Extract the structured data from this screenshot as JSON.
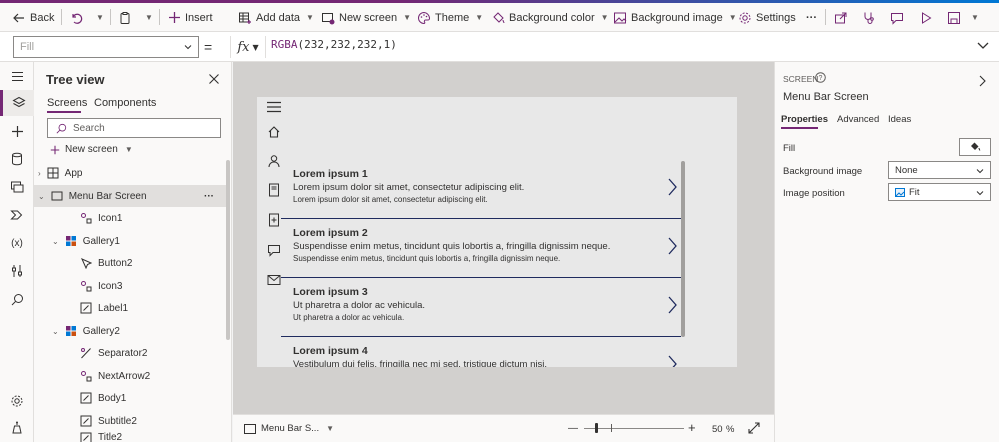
{
  "toolbar": {
    "back": "Back",
    "insert": "Insert",
    "add_data": "Add data",
    "new_screen": "New screen",
    "theme": "Theme",
    "background_color": "Background color",
    "background_image": "Background image",
    "settings": "Settings",
    "more": "···"
  },
  "formula": {
    "property": "Fill",
    "equals": "=",
    "fx": "fx",
    "fn": "RGBA",
    "args": "(232,232,232,1)"
  },
  "tree": {
    "title": "Tree view",
    "tabs": [
      "Screens",
      "Components"
    ],
    "search_placeholder": "Search",
    "new_screen": "New screen",
    "nodes": [
      {
        "label": "App",
        "icon": "app-icon"
      },
      {
        "label": "Menu Bar Screen",
        "icon": "screen-icon",
        "more": "···"
      },
      {
        "label": "Icon1",
        "icon": "icon-control-icon"
      },
      {
        "label": "Gallery1",
        "icon": "gallery-icon"
      },
      {
        "label": "Button2",
        "icon": "button-icon"
      },
      {
        "label": "Icon3",
        "icon": "icon-control-icon"
      },
      {
        "label": "Label1",
        "icon": "label-icon"
      },
      {
        "label": "Gallery2",
        "icon": "gallery-icon"
      },
      {
        "label": "Separator2",
        "icon": "shape-icon"
      },
      {
        "label": "NextArrow2",
        "icon": "icon-control-icon"
      },
      {
        "label": "Body1",
        "icon": "label-icon"
      },
      {
        "label": "Subtitle2",
        "icon": "label-icon"
      },
      {
        "label": "Title2",
        "icon": "label-icon"
      }
    ]
  },
  "gallery": {
    "items": [
      {
        "title": "Lorem ipsum 1",
        "subtitle": "Lorem ipsum dolor sit amet, consectetur adipiscing elit.",
        "body": "Lorem ipsum dolor sit amet, consectetur adipiscing elit."
      },
      {
        "title": "Lorem ipsum 2",
        "subtitle": "Suspendisse enim metus, tincidunt quis lobortis a, fringilla dignissim neque.",
        "body": "Suspendisse enim metus, tincidunt quis lobortis a, fringilla dignissim neque."
      },
      {
        "title": "Lorem ipsum 3",
        "subtitle": "Ut pharetra a dolor ac vehicula.",
        "body": "Ut pharetra a dolor ac vehicula."
      },
      {
        "title": "Lorem ipsum 4",
        "subtitle": "Vestibulum dui felis, fringilla nec mi sed, tristique dictum nisi.",
        "body": ""
      }
    ]
  },
  "statusbar": {
    "screen": "Menu Bar S...",
    "zoom_minus": "—",
    "zoom_plus": "+",
    "zoom_value": "50",
    "zoom_unit": "%"
  },
  "properties": {
    "header": "SCREEN",
    "name": "Menu Bar Screen",
    "tabs": [
      "Properties",
      "Advanced",
      "Ideas"
    ],
    "fill_label": "Fill",
    "bg_image_label": "Background image",
    "bg_image_value": "None",
    "image_position_label": "Image position",
    "image_position_value": "Fit"
  },
  "colors": {
    "accent": "#742774",
    "canvas": "#d2d0ce",
    "screen_fill": "#e8e8e8",
    "separator": "#1f2b5e"
  }
}
